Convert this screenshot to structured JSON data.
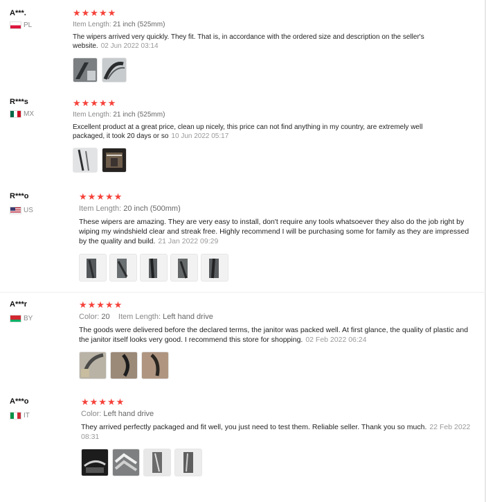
{
  "reviews": [
    {
      "user": "A***.",
      "country_code": "PL",
      "flag": "pl",
      "stars": "★★★★★",
      "attrs": [
        {
          "label": "Item Length:",
          "value": "21 inch (525mm)"
        }
      ],
      "text": "The wipers arrived very quickly. They fit. That is, in accordance with the ordered size and description on the seller's website.",
      "date": "02 Jun 2022 03:14",
      "thumb_count": 2
    },
    {
      "user": "R***s",
      "country_code": "MX",
      "flag": "mx",
      "stars": "★★★★★",
      "attrs": [
        {
          "label": "Item Length:",
          "value": "21 inch (525mm)"
        }
      ],
      "text": "Excellent product at a great price, clean up nicely, this price can not find anything in my country, are extremely well packaged, it took 20 days or so",
      "date": "10 Jun 2022 05:17",
      "thumb_count": 2
    },
    {
      "user": "R***o",
      "country_code": "US",
      "flag": "us",
      "stars": "★★★★★",
      "attrs": [
        {
          "label": "Item Length:",
          "value": "20 inch (500mm)"
        }
      ],
      "text": "These wipers are amazing. They are very easy to install, don't require any tools whatsoever they also do the job right by wiping my windshield clear and streak free. Highly recommend I will be purchasing some for family as they are impressed by the quality and build.",
      "date": "21 Jan 2022 09:29",
      "thumb_count": 5
    },
    {
      "user": "A***r",
      "country_code": "BY",
      "flag": "by",
      "stars": "★★★★★",
      "attrs": [
        {
          "label": "Color:",
          "value": "20"
        },
        {
          "label": "Item Length:",
          "value": "Left hand drive"
        }
      ],
      "text": "The goods were delivered before the declared terms, the janitor was packed well. At first glance, the quality of plastic and the janitor itself looks very good. I recommend this store for shopping.",
      "date": "02 Feb 2022 06:24",
      "thumb_count": 3
    },
    {
      "user": "A***o",
      "country_code": "IT",
      "flag": "it",
      "stars": "★★★★★",
      "attrs": [
        {
          "label": "Color:",
          "value": "Left hand drive"
        }
      ],
      "text": "They arrived perfectly packaged and fit well, you just need to test them. Reliable seller. Thank you so much.",
      "date": "22 Feb 2022 08:31",
      "thumb_count": 4
    }
  ]
}
